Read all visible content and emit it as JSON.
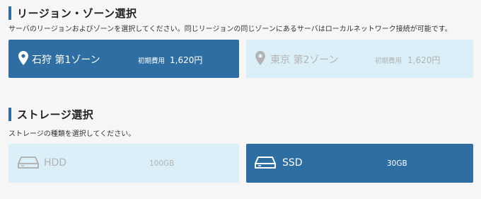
{
  "region_section": {
    "title": "リージョン・ゾーン選択",
    "description": "サーバのリージョンおよびゾーンを選択してください。同じリージョンの同じゾーンにあるサーバはローカルネットワーク接続が可能です。",
    "options": [
      {
        "name": "石狩 第1ゾーン",
        "price_label": "初期費用",
        "price": "1,620円",
        "selected": true,
        "icon": "map-pin-icon"
      },
      {
        "name": "東京 第2ゾーン",
        "price_label": "初期費用",
        "price": "1,620円",
        "selected": false,
        "icon": "map-pin-icon"
      }
    ]
  },
  "storage_section": {
    "title": "ストレージ選択",
    "description": "ストレージの種類を選択してください。",
    "options": [
      {
        "name": "HDD",
        "capacity": "100GB",
        "selected": false,
        "icon": "hard-drive-icon"
      },
      {
        "name": "SSD",
        "capacity": "30GB",
        "selected": true,
        "icon": "hard-drive-icon"
      }
    ]
  },
  "colors": {
    "accent": "#2f6ea3",
    "unselected_bg": "#daeff7",
    "unselected_text": "#b3b3b3",
    "page_bg": "#f6f6f6"
  }
}
